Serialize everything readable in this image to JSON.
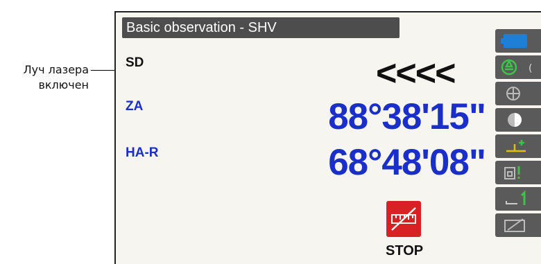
{
  "annotation": {
    "line1": "Луч лазера",
    "line2": "включен"
  },
  "screen": {
    "title": "Basic observation - SHV",
    "sd_label": "SD",
    "laser_indicator": "<<<<",
    "za_label": "ZA",
    "za_value": "88°38'15\"",
    "har_label": "HA-R",
    "har_value": "68°48'08\"",
    "stop_label": "STOP"
  },
  "icons": [
    "battery-icon",
    "target-icon",
    "crosshair-icon",
    "half-circle-icon",
    "tilt-icon",
    "wall-icon",
    "level-1-icon",
    "edit-icon"
  ],
  "colors": {
    "value_blue": "#1a2ec9",
    "stop_red": "#d82125",
    "icon_green": "#3fc24a",
    "titlebar": "#4d4d4d"
  }
}
